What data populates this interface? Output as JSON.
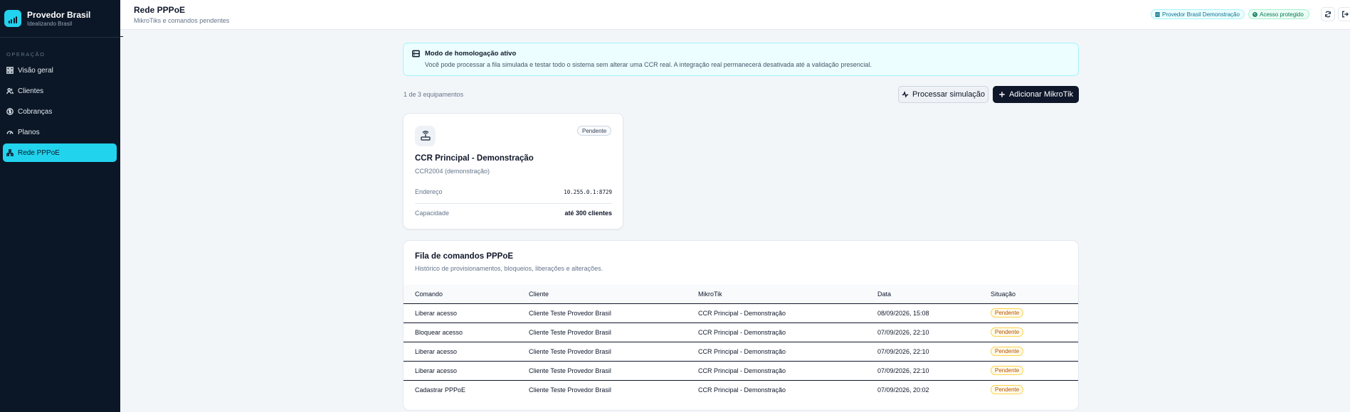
{
  "brand": {
    "name": "Provedor Brasil",
    "subtitle": "Idealizando Brasil"
  },
  "sidebar": {
    "section": "OPERAÇÃO",
    "items": [
      {
        "label": "Visão geral",
        "icon": "grid-icon",
        "active": false
      },
      {
        "label": "Clientes",
        "icon": "users-icon",
        "active": false
      },
      {
        "label": "Cobranças",
        "icon": "dollar-circle-icon",
        "active": false
      },
      {
        "label": "Planos",
        "icon": "gauge-icon",
        "active": false
      },
      {
        "label": "Rede PPPoE",
        "icon": "network-icon",
        "active": true
      }
    ]
  },
  "header": {
    "title": "Rede PPPoE",
    "subtitle": "MikroTiks e comandos pendentes",
    "chip_brand": "Provedor Brasil Demonstração",
    "chip_secure": "Acesso protegido"
  },
  "notice": {
    "title": "Modo de homologação ativo",
    "text": "Você pode processar a fila simulada e testar todo o sistema sem alterar uma CCR real. A integração real permanecerá desativada até a validação presencial."
  },
  "toolbar": {
    "count": "1 de 3 equipamentos",
    "simulate_label": "Processar simulação",
    "add_label": "Adicionar MikroTik"
  },
  "device": {
    "status": "Pendente",
    "name": "CCR Principal - Demonstração",
    "model": "CCR2004 (demonstração)",
    "address_label": "Endereço",
    "address_value": "10.255.0.1:8729",
    "capacity_label": "Capacidade",
    "capacity_value": "até 300 clientes"
  },
  "queue": {
    "title": "Fila de comandos PPPoE",
    "subtitle": "Histórico de provisionamentos, bloqueios, liberações e alterações.",
    "columns": [
      "Comando",
      "Cliente",
      "MikroTik",
      "Data",
      "Situação"
    ],
    "rows": [
      {
        "command": "Liberar acesso",
        "client": "Cliente Teste Provedor Brasil",
        "mikrotik": "CCR Principal - Demonstração",
        "date": "08/09/2026, 15:08",
        "status": "Pendente"
      },
      {
        "command": "Bloquear acesso",
        "client": "Cliente Teste Provedor Brasil",
        "mikrotik": "CCR Principal - Demonstração",
        "date": "07/09/2026, 22:10",
        "status": "Pendente"
      },
      {
        "command": "Liberar acesso",
        "client": "Cliente Teste Provedor Brasil",
        "mikrotik": "CCR Principal - Demonstração",
        "date": "07/09/2026, 22:10",
        "status": "Pendente"
      },
      {
        "command": "Liberar acesso",
        "client": "Cliente Teste Provedor Brasil",
        "mikrotik": "CCR Principal - Demonstração",
        "date": "07/09/2026, 22:10",
        "status": "Pendente"
      },
      {
        "command": "Cadastrar PPPoE",
        "client": "Cliente Teste Provedor Brasil",
        "mikrotik": "CCR Principal - Demonstração",
        "date": "07/09/2026, 20:02",
        "status": "Pendente"
      }
    ]
  },
  "colors": {
    "accent": "#22d3ee",
    "sidebar_bg": "#0b1726",
    "dark_button": "#0f172a",
    "pending": "#b45309"
  }
}
